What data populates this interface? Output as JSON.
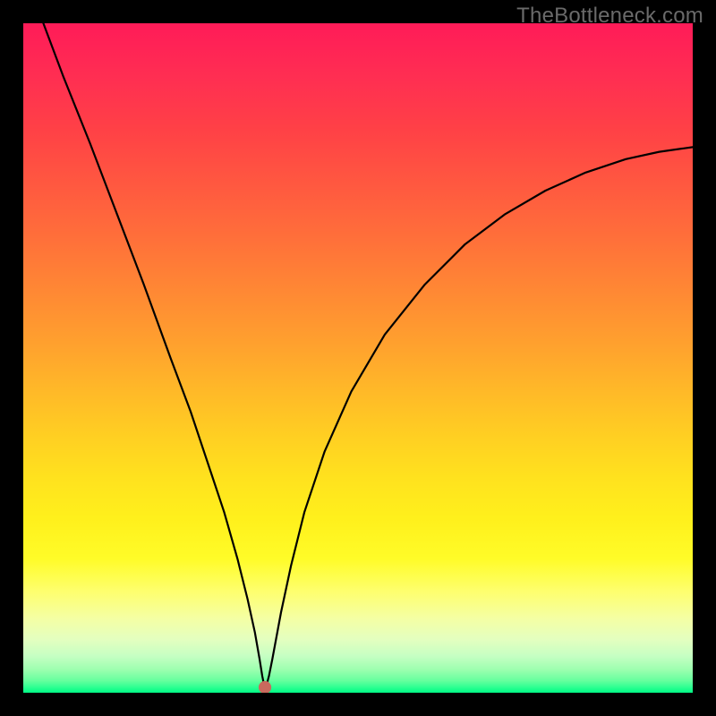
{
  "watermark": "TheBottleneck.com",
  "chart_data": {
    "type": "line",
    "title": "",
    "xlabel": "",
    "ylabel": "",
    "xlim": [
      0,
      100
    ],
    "ylim": [
      0,
      100
    ],
    "grid": false,
    "legend": false,
    "annotations": [],
    "series": [
      {
        "name": "curve",
        "x": [
          3,
          6,
          10,
          14,
          18,
          22,
          25,
          28,
          30,
          32,
          33.5,
          34.6,
          35.3,
          35.7,
          36.0,
          36.3,
          36.7,
          37.2,
          38.5,
          40,
          42,
          45,
          49,
          54,
          60,
          66,
          72,
          78,
          84,
          90,
          95,
          100
        ],
        "y": [
          100,
          92,
          82,
          71.5,
          61,
          50,
          42,
          33,
          27,
          20,
          14,
          9,
          5,
          2.5,
          1,
          1,
          2.5,
          5,
          12,
          19,
          27,
          36,
          45,
          53.5,
          61,
          67,
          71.5,
          75,
          77.7,
          79.7,
          80.8,
          81.5
        ]
      }
    ],
    "marker": {
      "x": 36.1,
      "y": 0.8,
      "color": "#c96a5d",
      "radius_pct": 0.95
    },
    "gradient_stops": [
      {
        "pos": 0.0,
        "color": "#ff1b58"
      },
      {
        "pos": 0.16,
        "color": "#ff4146"
      },
      {
        "pos": 0.32,
        "color": "#ff6f3a"
      },
      {
        "pos": 0.48,
        "color": "#ffa12e"
      },
      {
        "pos": 0.62,
        "color": "#ffd022"
      },
      {
        "pos": 0.74,
        "color": "#fff01c"
      },
      {
        "pos": 0.85,
        "color": "#feff70"
      },
      {
        "pos": 0.92,
        "color": "#e4ffbf"
      },
      {
        "pos": 0.965,
        "color": "#9effb0"
      },
      {
        "pos": 1.0,
        "color": "#00f985"
      }
    ]
  }
}
